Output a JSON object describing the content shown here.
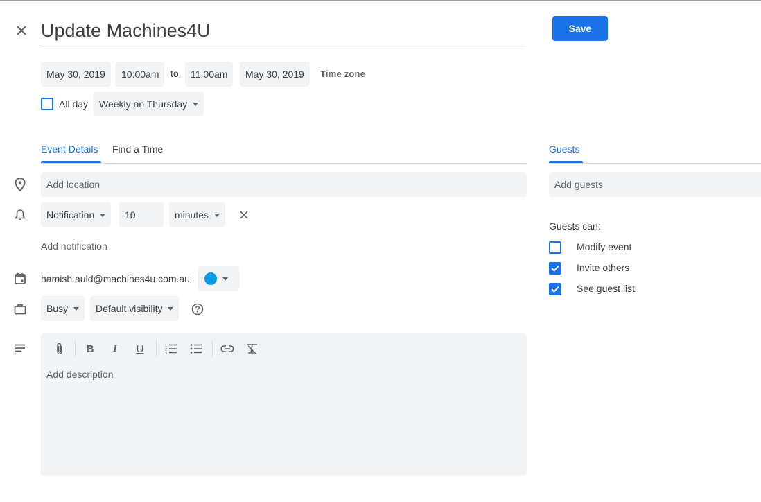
{
  "header": {
    "title": "Update Machines4U",
    "save_label": "Save"
  },
  "datetime": {
    "start_date": "May 30, 2019",
    "start_time": "10:00am",
    "to": "to",
    "end_time": "11:00am",
    "end_date": "May 30, 2019",
    "timezone_label": "Time zone",
    "allday_label": "All day",
    "allday_checked": false,
    "recurrence": "Weekly on Thursday"
  },
  "tabs": [
    {
      "label": "Event Details",
      "active": true
    },
    {
      "label": "Find a Time",
      "active": false
    }
  ],
  "details": {
    "location_placeholder": "Add location",
    "notification_type": "Notification",
    "notification_value": "10",
    "notification_unit": "minutes",
    "add_notification_label": "Add notification",
    "calendar_owner": "hamish.auld@machines4u.com.au",
    "calendar_color": "#039be5",
    "availability": "Busy",
    "visibility": "Default visibility",
    "description_placeholder": "Add description"
  },
  "guests": {
    "tab_label": "Guests",
    "add_placeholder": "Add guests",
    "permissions_title": "Guests can:",
    "permissions": [
      {
        "label": "Modify event",
        "checked": false
      },
      {
        "label": "Invite others",
        "checked": true
      },
      {
        "label": "See guest list",
        "checked": true
      }
    ]
  },
  "colors": {
    "accent": "#1a73e8",
    "chip_bg": "#f1f3f4",
    "text": "#3c4043",
    "icon": "#5f6368"
  }
}
